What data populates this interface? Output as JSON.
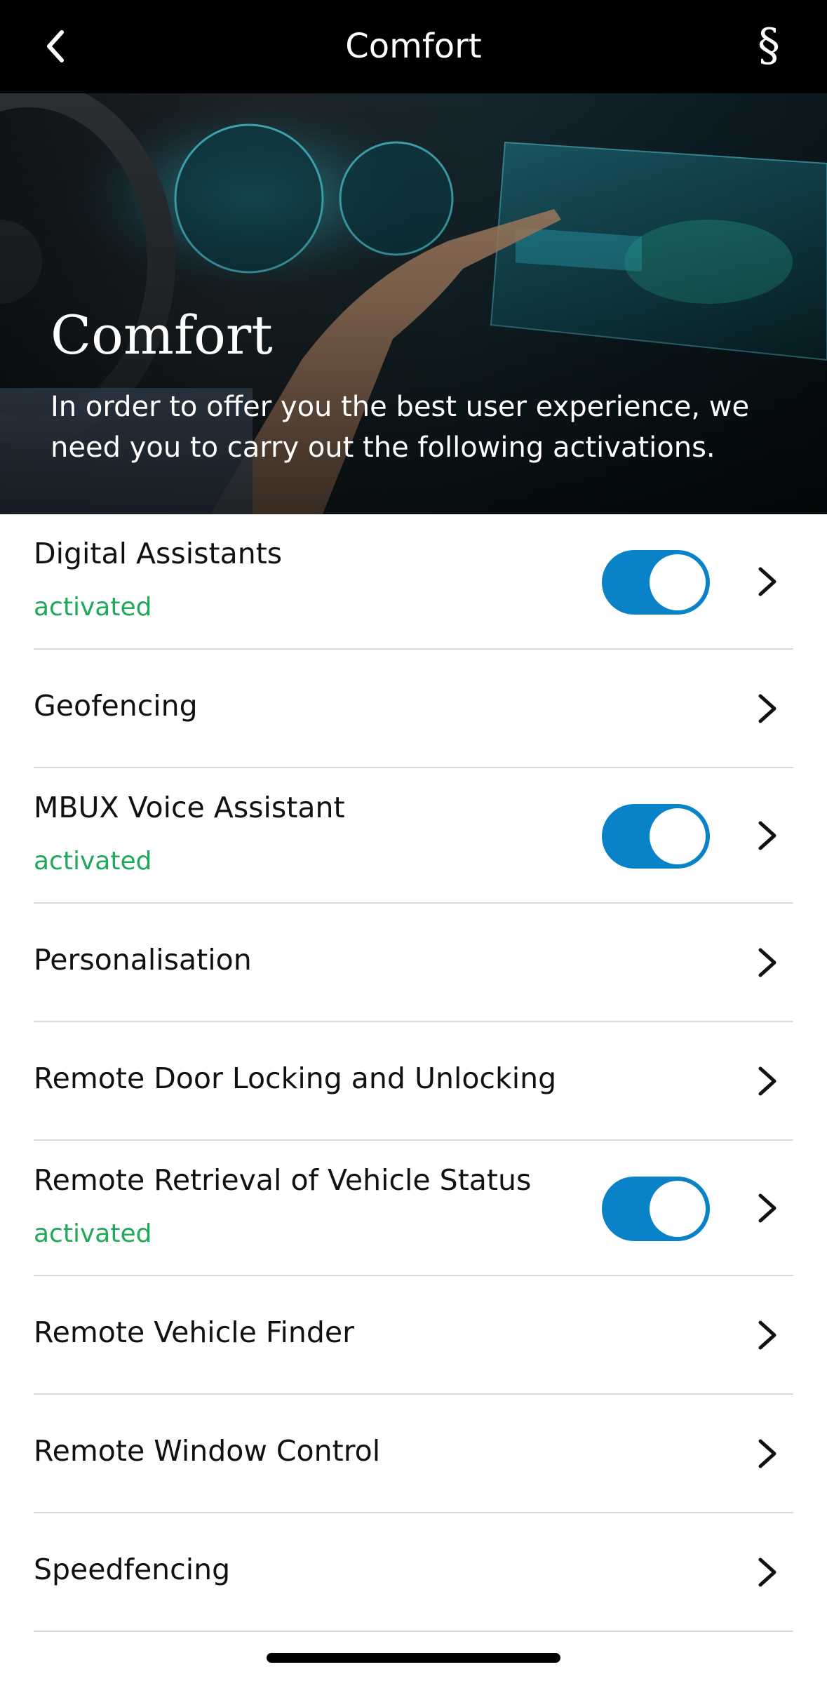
{
  "nav": {
    "title": "Comfort",
    "back_icon": "chevron-left-icon",
    "legal_icon": "section-sign-icon",
    "legal_glyph": "§"
  },
  "hero": {
    "title": "Comfort",
    "text": "In order to offer you the best user experience, we need you to carry out the following activations."
  },
  "items": [
    {
      "label": "Digital Assistants",
      "status": "activated",
      "toggle_on": true
    },
    {
      "label": "Geofencing"
    },
    {
      "label": "MBUX Voice Assistant",
      "status": "activated",
      "toggle_on": true
    },
    {
      "label": "Personalisation"
    },
    {
      "label": "Remote Door Locking and Unlocking"
    },
    {
      "label": "Remote Retrieval of Vehicle Status",
      "status": "activated",
      "toggle_on": true
    },
    {
      "label": "Remote Vehicle Finder"
    },
    {
      "label": "Remote Window Control"
    },
    {
      "label": "Speedfencing"
    }
  ],
  "colors": {
    "toggle_on": "#0a82c8",
    "status_green": "#1fa85a",
    "navbar_bg": "#000000"
  }
}
